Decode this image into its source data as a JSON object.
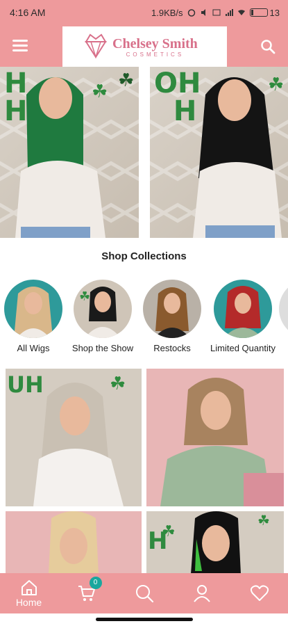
{
  "status_bar": {
    "time": "4:16 AM",
    "speed": "1.9KB/s",
    "battery": "13"
  },
  "header": {
    "brand_name": "Chelsey Smith",
    "brand_sub": "COSMETICS",
    "menu_icon": "hamburger-menu-icon",
    "search_icon": "search-icon"
  },
  "banner": {
    "slide_count": 2,
    "active_slide": 1
  },
  "collections": {
    "title": "Shop Collections",
    "items": [
      {
        "label": "All Wigs",
        "hair": "#d9b78a",
        "bg": "#2e9a9a"
      },
      {
        "label": "Shop the Show",
        "hair": "#1a1a1a",
        "bg": "#cfc5b8"
      },
      {
        "label": "Restocks",
        "hair": "#8a5a2e",
        "bg": "#b9b1a7"
      },
      {
        "label": "Limited Quantity",
        "hair": "#b42a2a",
        "bg": "#2e9a9a"
      }
    ]
  },
  "bottom_nav": {
    "home_label": "Home",
    "cart_count": "0"
  },
  "colors": {
    "brand_pink": "#ee9a9c",
    "logo_pink": "#d8708a",
    "badge_teal": "#1aa79e"
  }
}
